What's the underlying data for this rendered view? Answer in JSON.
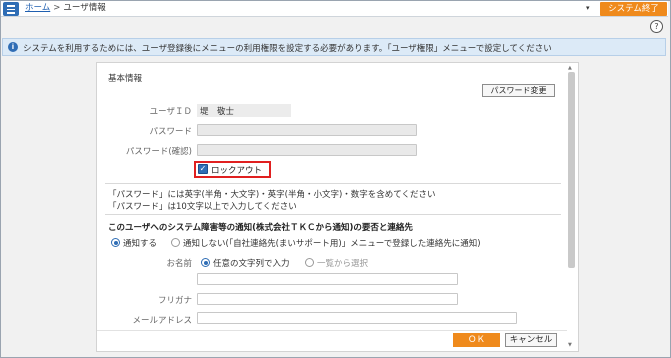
{
  "header": {
    "home_link": "ホーム",
    "separator": ">",
    "current_page": "ユーザ情報",
    "dropdown_caret": "▾",
    "exit_button": "システム終了",
    "help_icon": "?"
  },
  "info": {
    "icon": "i",
    "message": "システムを利用するためには、ユーザ登録後にメニューの利用権限を設定する必要があります。「ユーザ権限」メニューで設定してください"
  },
  "basic": {
    "section_title": "基本情報",
    "password_change_button": "パスワード変更",
    "user_id_label": "ユーザＩＤ",
    "user_id_value": "堤　敬士",
    "password_label": "パスワード",
    "password_value": "",
    "password_confirm_label": "パスワード(確認)",
    "password_confirm_value": "",
    "lockout_label": "ロックアウト",
    "lockout_checked": true,
    "note_line1": "「パスワード」には英字(半角・大文字)・英字(半角・小文字)・数字を含めてください",
    "note_line2": "「パスワード」は10文字以上で入力してください"
  },
  "notify": {
    "section_title": "このユーザへのシステム障害等の通知(株式会社ＴＫＣから通知)の要否と連絡先",
    "option_notify": "通知する",
    "option_no_notify": "通知しない(「自社連絡先(まいサポート用)」メニューで登録した連絡先に通知)",
    "name_label": "お名前",
    "name_option_free": "任意の文字列で入力",
    "name_option_list": "一覧から選択",
    "name_value": "",
    "furigana_label": "フリガナ",
    "furigana_value": "",
    "email_label": "メールアドレス",
    "email_value": ""
  },
  "footer": {
    "ok_button": "ＯＫ",
    "cancel_button": "キャンセル"
  },
  "colors": {
    "accent_orange": "#ef8a1c",
    "primary_blue": "#2f6db5",
    "info_bg": "#dceaf7",
    "highlight_red": "#e02020"
  }
}
